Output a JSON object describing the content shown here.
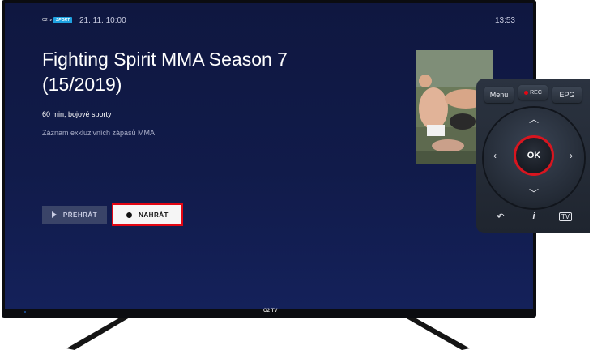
{
  "header": {
    "logo_o2": "O2 tv",
    "logo_sport": "SPORT",
    "datetime": "21. 11. 10:00",
    "clock": "13:53"
  },
  "program": {
    "title_line1": "Fighting Spirit MMA Season 7",
    "title_line2": "(15/2019)",
    "meta": "60 min, bojové sporty",
    "description": "Záznam exkluzivních zápasů MMA"
  },
  "buttons": {
    "play_label": "PŘEHRÁT",
    "record_label": "NAHRÁT"
  },
  "tv": {
    "brand": "O2 TV"
  },
  "remote": {
    "menu": "Menu",
    "rec": "REC",
    "epg": "EPG",
    "ok": "OK",
    "info": "i",
    "tv": "TV"
  },
  "colors": {
    "accent_red": "#e30613",
    "screen_bg": "#111b4a",
    "sport_blue": "#1fa2e0"
  }
}
